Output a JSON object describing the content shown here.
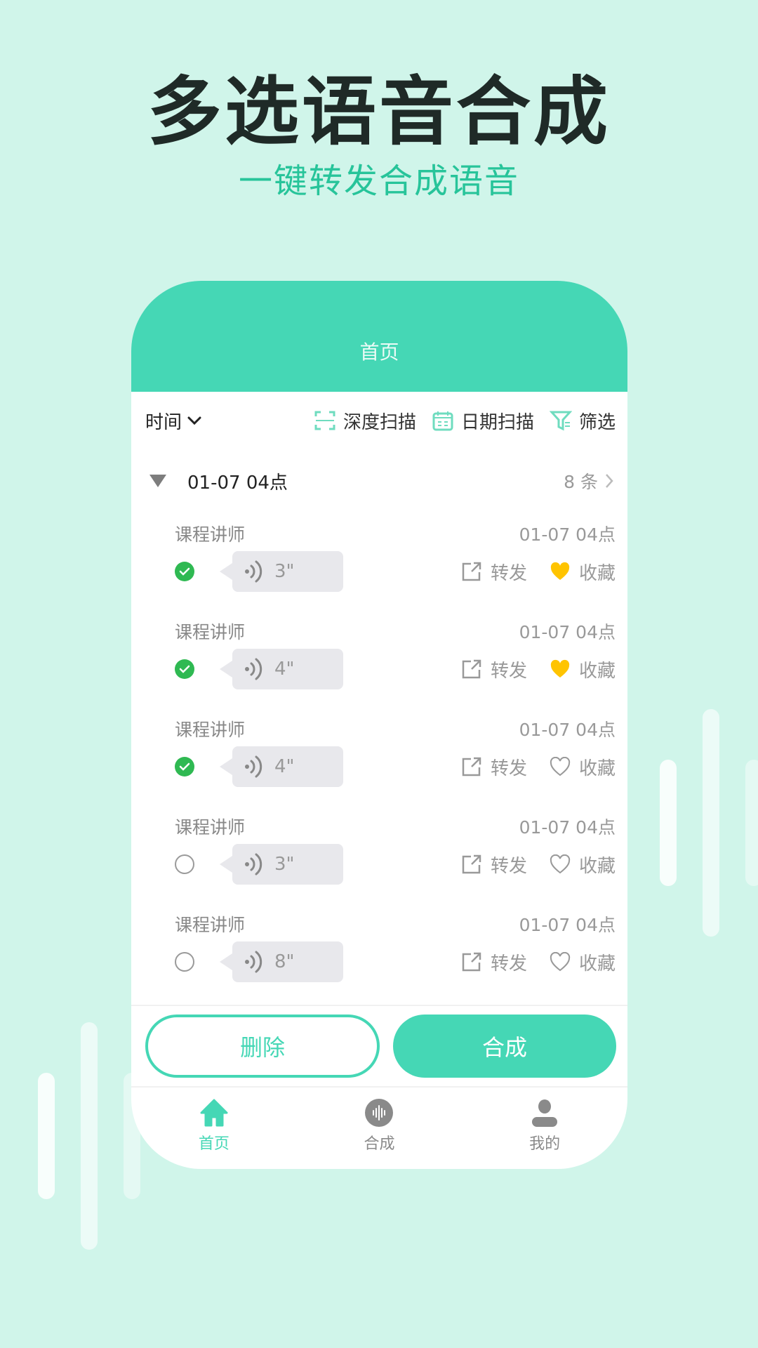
{
  "promo": {
    "headline": "多选语音合成",
    "subheadline": "一键转发合成语音"
  },
  "colors": {
    "accent": "#45d7b5",
    "background": "#d0f5ea",
    "checked": "#2fb952",
    "favorite": "#ffc400"
  },
  "app": {
    "header_title": "首页",
    "toolbar": {
      "sort_label": "时间",
      "actions": [
        {
          "label": "深度扫描",
          "icon": "scan-icon"
        },
        {
          "label": "日期扫描",
          "icon": "calendar-icon"
        },
        {
          "label": "筛选",
          "icon": "filter-icon"
        }
      ]
    },
    "group": {
      "title": "01-07 04点",
      "count": "8 条"
    },
    "items": [
      {
        "name": "课程讲师",
        "time": "01-07 04点",
        "duration": "3\"",
        "checked": true,
        "favorited": true,
        "forward_label": "转发",
        "favorite_label": "收藏"
      },
      {
        "name": "课程讲师",
        "time": "01-07 04点",
        "duration": "4\"",
        "checked": true,
        "favorited": true,
        "forward_label": "转发",
        "favorite_label": "收藏"
      },
      {
        "name": "课程讲师",
        "time": "01-07 04点",
        "duration": "4\"",
        "checked": true,
        "favorited": false,
        "forward_label": "转发",
        "favorite_label": "收藏"
      },
      {
        "name": "课程讲师",
        "time": "01-07 04点",
        "duration": "3\"",
        "checked": false,
        "favorited": false,
        "forward_label": "转发",
        "favorite_label": "收藏"
      },
      {
        "name": "课程讲师",
        "time": "01-07 04点",
        "duration": "8\"",
        "checked": false,
        "favorited": false,
        "forward_label": "转发",
        "favorite_label": "收藏"
      }
    ],
    "buttons": {
      "delete_label": "删除",
      "synthesize_label": "合成"
    },
    "tabbar": [
      {
        "label": "首页",
        "icon": "home-icon",
        "active": true
      },
      {
        "label": "合成",
        "icon": "waveform-icon",
        "active": false
      },
      {
        "label": "我的",
        "icon": "user-icon",
        "active": false
      }
    ]
  }
}
